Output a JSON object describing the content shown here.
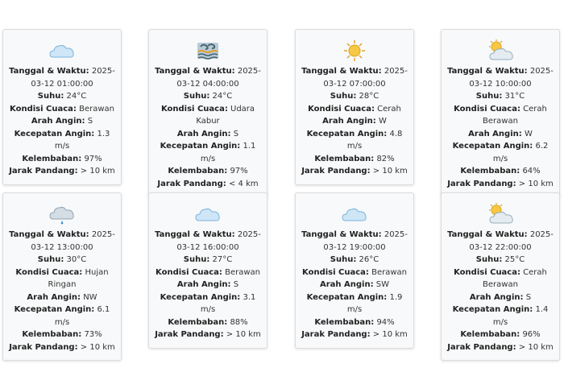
{
  "labels": {
    "datetime": "Tanggal & Waktu:",
    "temp": "Suhu:",
    "condition": "Kondisi Cuaca:",
    "wind_dir": "Arah Angin:",
    "wind_speed": "Kecepatan Angin:",
    "humidity": "Kelembaban:",
    "visibility": "Jarak Pandang:"
  },
  "cards": [
    {
      "icon": "cloud-icon",
      "datetime": "2025-03-12 01:00:00",
      "temp": "24°C",
      "condition": "Berawan",
      "wind_dir": "S",
      "wind_speed": "1.3 m/s",
      "humidity": "97%",
      "visibility": "> 10 km"
    },
    {
      "icon": "fog-icon",
      "datetime": "2025-03-12 04:00:00",
      "temp": "24°C",
      "condition": "Udara Kabur",
      "wind_dir": "S",
      "wind_speed": "1.1 m/s",
      "humidity": "97%",
      "visibility": "< 4 km"
    },
    {
      "icon": "sun-icon",
      "datetime": "2025-03-12 07:00:00",
      "temp": "28°C",
      "condition": "Cerah",
      "wind_dir": "W",
      "wind_speed": "4.8 m/s",
      "humidity": "82%",
      "visibility": "> 10 km"
    },
    {
      "icon": "sun-cloud-icon",
      "datetime": "2025-03-12 10:00:00",
      "temp": "31°C",
      "condition": "Cerah Berawan",
      "wind_dir": "W",
      "wind_speed": "6.2 m/s",
      "humidity": "64%",
      "visibility": "> 10 km"
    },
    {
      "icon": "rain-cloud-icon",
      "datetime": "2025-03-12 13:00:00",
      "temp": "30°C",
      "condition": "Hujan Ringan",
      "wind_dir": "NW",
      "wind_speed": "6.1 m/s",
      "humidity": "73%",
      "visibility": "> 10 km"
    },
    {
      "icon": "cloud-icon",
      "datetime": "2025-03-12 16:00:00",
      "temp": "27°C",
      "condition": "Berawan",
      "wind_dir": "S",
      "wind_speed": "3.1 m/s",
      "humidity": "88%",
      "visibility": "> 10 km"
    },
    {
      "icon": "cloud-icon",
      "datetime": "2025-03-12 19:00:00",
      "temp": "26°C",
      "condition": "Berawan",
      "wind_dir": "SW",
      "wind_speed": "1.9 m/s",
      "humidity": "94%",
      "visibility": "> 10 km"
    },
    {
      "icon": "sun-cloud-icon",
      "datetime": "2025-03-12 22:00:00",
      "temp": "25°C",
      "condition": "Cerah Berawan",
      "wind_dir": "S",
      "wind_speed": "1.4 m/s",
      "humidity": "96%",
      "visibility": "> 10 km"
    }
  ]
}
